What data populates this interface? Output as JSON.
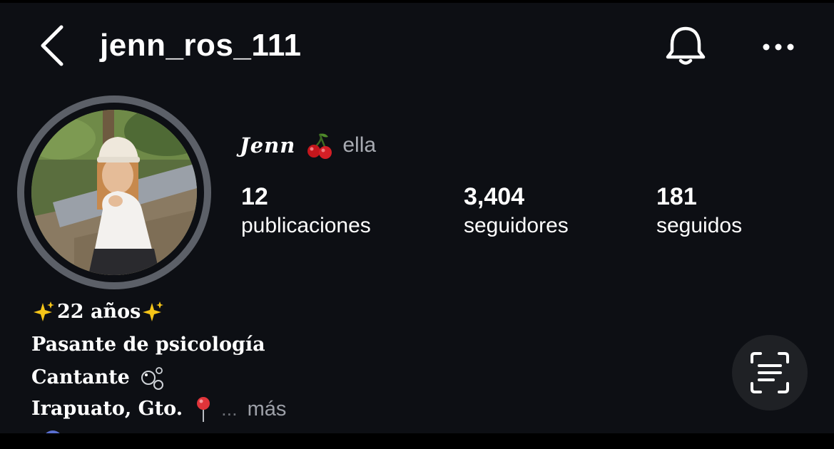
{
  "header": {
    "username": "jenn_ros_111",
    "back_icon": "chevron-left-icon",
    "bell_icon": "bell-icon",
    "more_icon": "more-horizontal-icon"
  },
  "profile": {
    "display_name": "Jenn",
    "name_emoji": "cherry-icon",
    "pronouns": "ella"
  },
  "stats": [
    {
      "value": "12",
      "label": "publicaciones"
    },
    {
      "value": "3,404",
      "label": "seguidores"
    },
    {
      "value": "181",
      "label": "seguidos"
    }
  ],
  "bio": {
    "line1": "22 años",
    "line2": "Pasante de psicología",
    "line3": "Cantante",
    "line4": "Irapuato, Gto.",
    "ellipsis": "...",
    "more_label": "más"
  },
  "colors": {
    "background": "#0d0f14",
    "text": "#ffffff",
    "muted": "#a8abb2",
    "avatar_ring": "#5c6068",
    "scan_button": "#1f2125"
  }
}
